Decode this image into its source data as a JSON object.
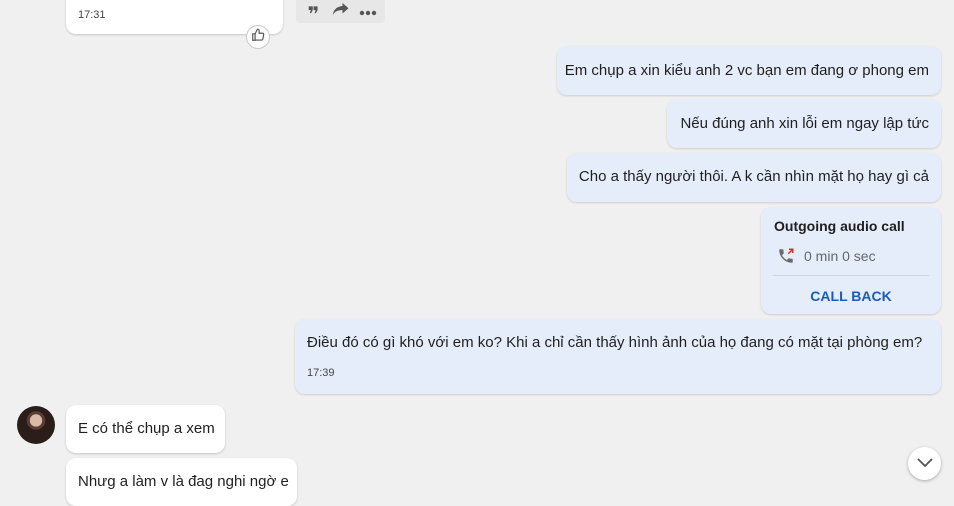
{
  "messages": {
    "top_incoming": {
      "time": "17:31"
    },
    "out1": {
      "text": "Em chụp a xin kiểu anh 2 vc bạn em đang ơ phong em"
    },
    "out2": {
      "text": "Nếu đúng anh xin lỗi em ngay lập tức"
    },
    "out3": {
      "text": "Cho a thấy người thôi. A k cần nhìn mặt họ hay gì cả"
    },
    "call": {
      "title": "Outgoing audio call",
      "duration": "0 min 0 sec",
      "callback_label": "CALL BACK"
    },
    "out4": {
      "text": "Điều đó có gì khó với em ko? Khi a chỉ  cần thấy hình ảnh của họ đang có mặt  tại phòng em?",
      "time": "17:39"
    },
    "in1": {
      "text": "E có thể chụp a xem"
    },
    "in2": {
      "text": "Nhưg a làm v là đag nghi ngờ e"
    }
  },
  "toolbar": {
    "icons": [
      "quote-icon",
      "forward-icon",
      "more-icon"
    ]
  },
  "colors": {
    "background": "#f0f0f0",
    "outgoing_bubble": "#e6edfa",
    "incoming_bubble": "#ffffff",
    "callback_accent": "#1a5bbf",
    "missed_call_red": "#d93025"
  }
}
